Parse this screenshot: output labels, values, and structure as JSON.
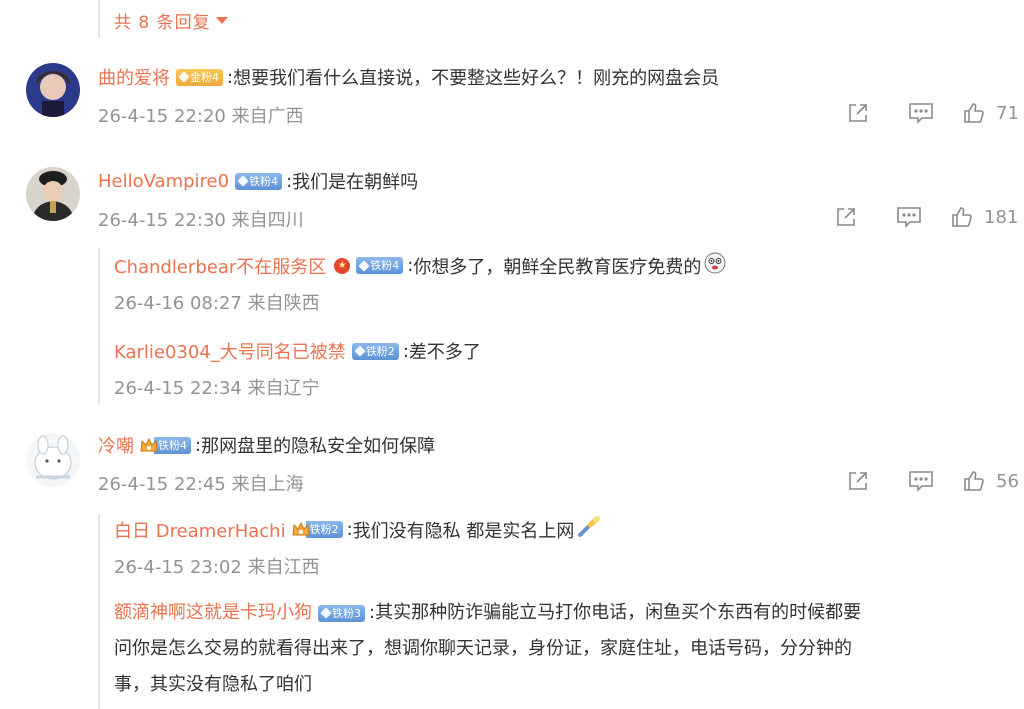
{
  "more_replies": {
    "label": "共 8 条回复"
  },
  "comments": [
    {
      "username": "曲的爱将",
      "badge": "金粉4",
      "text": "想要我们看什么直接说，不要整这些好么？！刚充的网盘会员",
      "meta": "26-4-15 22:20  来自广西",
      "likes": "71"
    },
    {
      "username": "HelloVampire0",
      "badge": "铁粉4",
      "text": "我们是在朝鲜吗",
      "meta": "26-4-15 22:30  来自四川",
      "likes": "181",
      "replies": [
        {
          "username": "Chandlerbear不在服务区",
          "badge": "铁粉4",
          "text": "你想多了，朝鲜全民教育医疗免费的",
          "meta": "26-4-16 08:27  来自陕西"
        },
        {
          "username": "Karlie0304_大号同名已被禁",
          "badge": "铁粉2",
          "text": "差不多了",
          "meta": "26-4-15 22:34  来自辽宁"
        }
      ]
    },
    {
      "username": "冷嘲",
      "badge": "铁粉4",
      "text": "那网盘里的隐私安全如何保障",
      "meta": "26-4-15 22:45  来自上海",
      "likes": "56",
      "replies": [
        {
          "username": "白日 DreamerHachi",
          "badge": "铁粉2",
          "text": "我们没有隐私 都是实名上网",
          "meta": "26-4-15 23:02  来自江西"
        },
        {
          "username": "额滴神啊这就是卡玛小狗",
          "badge": "铁粉3",
          "text_lines": [
            "其实那种防诈骗能立马打你电话，闲鱼买个东西有的时候都要",
            "问你是怎么交易的就看得出来了，想调你聊天记录，身份证，家庭住址，电话号码，分分钟的",
            "事，其实没有隐私了咱们"
          ]
        }
      ]
    }
  ],
  "colors": {
    "username": "#eb7350",
    "meta": "#939393",
    "text": "#333333",
    "iron_badge": "#6a9fdf",
    "gold_badge": "#f3b445"
  },
  "icons": [
    "share-icon",
    "comment-icon",
    "like-icon",
    "caret-down-icon",
    "crown-icon",
    "vip-icon"
  ]
}
